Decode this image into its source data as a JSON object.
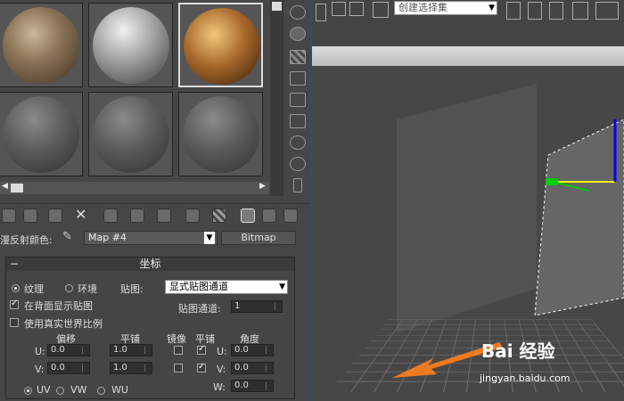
{
  "material_editor": {
    "slots": [
      "material-slot-1",
      "material-slot-2",
      "material-slot-3",
      "material-slot-4",
      "material-slot-5",
      "material-slot-6"
    ],
    "map_label": "漫反射颜色:",
    "map_name": "Map #4",
    "map_type": "Bitmap",
    "rollout_title": "坐标",
    "texture_label": "纹理",
    "environ_label": "环境",
    "mapping_label": "贴图:",
    "mapping_value": "显式贴图通道",
    "show_back_label": "在背面显示贴图",
    "map_channel_label": "贴图通道:",
    "map_channel_value": "1",
    "real_world_label": "使用真实世界比例",
    "col_offset": "偏移",
    "col_tiling": "平铺",
    "col_mirror": "镜像",
    "col_tile": "平铺",
    "col_angle": "角度",
    "u_label": "U:",
    "v_label": "V:",
    "w_label": "W:",
    "u_offset": "0.0",
    "v_offset": "0.0",
    "u_tiling": "1.0",
    "v_tiling": "1.0",
    "u_angle": "0.0",
    "v_angle": "0.0",
    "w_angle": "0.0",
    "uv_label": "UV",
    "vw_label": "VW",
    "wu_label": "WU"
  },
  "viewport": {
    "selection_set_placeholder": "创建选择集",
    "watermark_logo": "Bai 经验",
    "watermark_url": "jingyan.baidu.com"
  }
}
